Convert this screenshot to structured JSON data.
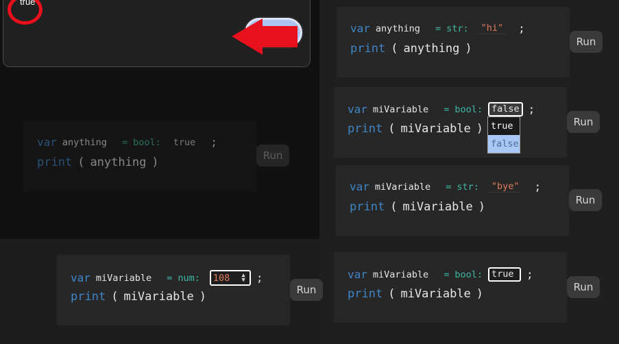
{
  "popup": {
    "output": "true"
  },
  "cards": [
    {
      "keyword": "var",
      "name": "anything",
      "eq": "=",
      "type": "str:",
      "value": "\"hi\"",
      "semi": ";",
      "print_fn": "print",
      "open": "(",
      "arg": "anything",
      "close": ")",
      "run": "Run"
    },
    {
      "keyword": "var",
      "name": "miVariable",
      "eq": "=",
      "type": "bool:",
      "value": "false",
      "semi": ";",
      "print_fn": "print",
      "open": "(",
      "arg": "miVariable",
      "close": ")",
      "run": "Run",
      "options": [
        "true",
        "false"
      ]
    },
    {
      "keyword": "var",
      "name": "anything",
      "eq": "=",
      "type": "bool:",
      "value": "true",
      "semi": ";",
      "print_fn": "print",
      "open": "(",
      "arg": "anything",
      "close": ")",
      "run": "Run"
    },
    {
      "keyword": "var",
      "name": "miVariable",
      "eq": "=",
      "type": "str:",
      "value": "\"bye\"",
      "semi": ";",
      "print_fn": "print",
      "open": "(",
      "arg": "miVariable",
      "close": ")",
      "run": "Run"
    },
    {
      "keyword": "var",
      "name": "miVariable",
      "eq": "=",
      "type": "num:",
      "value": "108",
      "semi": ";",
      "print_fn": "print",
      "open": "(",
      "arg": "miVariable",
      "close": ")",
      "run": "Run"
    },
    {
      "keyword": "var",
      "name": "miVariable",
      "eq": "=",
      "type": "bool:",
      "value": "true",
      "semi": ";",
      "print_fn": "print",
      "open": "(",
      "arg": "miVariable",
      "close": ")",
      "run": "Run"
    }
  ],
  "colors": {
    "keyword": "#3f86c9",
    "type": "#3fb9a3",
    "string": "#e07b5d",
    "annotation": "#e8101c",
    "highlight": "#a8c7f4"
  }
}
